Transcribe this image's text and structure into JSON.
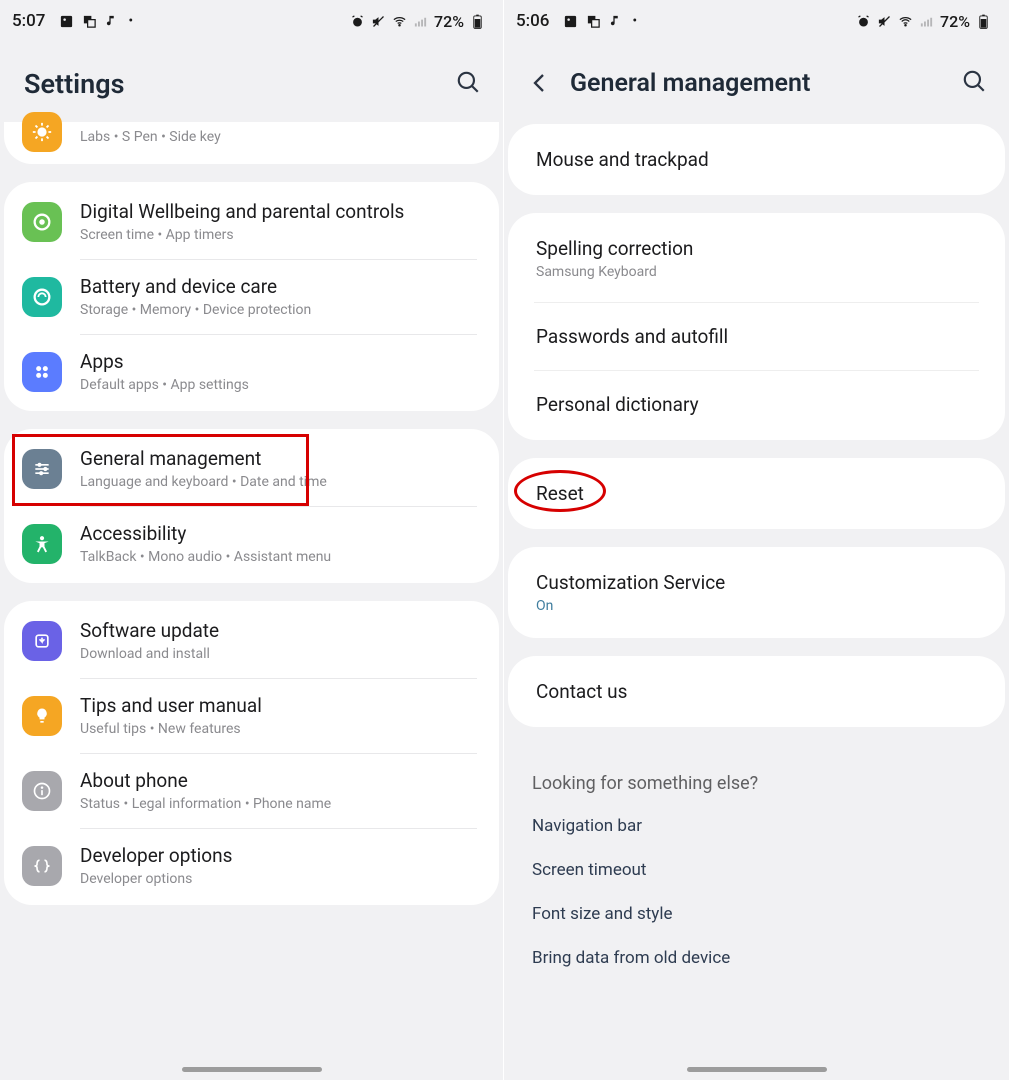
{
  "left": {
    "status": {
      "time": "5:07",
      "battery": "72%"
    },
    "title": "Settings",
    "advanced_sub": "Labs  •  S Pen  •  Side key",
    "groups": [
      [
        {
          "icon": "wellbeing",
          "color": "#69c154",
          "title": "Digital Wellbeing and parental controls",
          "sub": "Screen time  •  App timers"
        },
        {
          "icon": "battery",
          "color": "#1fb9a0",
          "title": "Battery and device care",
          "sub": "Storage  •  Memory  •  Device protection"
        },
        {
          "icon": "apps",
          "color": "#5b7cff",
          "title": "Apps",
          "sub": "Default apps  •  App settings"
        }
      ],
      [
        {
          "icon": "sliders",
          "color": "#6b8093",
          "title": "General management",
          "sub": "Language and keyboard  •  Date and time",
          "highlight": true
        },
        {
          "icon": "a11y",
          "color": "#23b36a",
          "title": "Accessibility",
          "sub": "TalkBack  •  Mono audio  •  Assistant menu"
        }
      ],
      [
        {
          "icon": "update",
          "color": "#6a62e6",
          "title": "Software update",
          "sub": "Download and install"
        },
        {
          "icon": "tips",
          "color": "#f5a623",
          "title": "Tips and user manual",
          "sub": "Useful tips  •  New features"
        },
        {
          "icon": "about",
          "color": "#a8a8ad",
          "title": "About phone",
          "sub": "Status  •  Legal information  •  Phone name"
        },
        {
          "icon": "dev",
          "color": "#a8a8ad",
          "title": "Developer options",
          "sub": "Developer options"
        }
      ]
    ]
  },
  "right": {
    "status": {
      "time": "5:06",
      "battery": "72%"
    },
    "title": "General management",
    "items": [
      {
        "title": "Mouse and trackpad"
      },
      {
        "divider": true
      },
      {
        "title": "Spelling correction",
        "sub": "Samsung Keyboard"
      },
      {
        "title": "Passwords and autofill"
      },
      {
        "title": "Personal dictionary"
      },
      {
        "divider": true
      },
      {
        "title": "Reset",
        "highlight": true
      },
      {
        "divider": true
      },
      {
        "title": "Customization Service",
        "sub": "On",
        "sub_color": "#3f7d9e"
      },
      {
        "divider": true
      },
      {
        "title": "Contact us"
      }
    ],
    "looking_header": "Looking for something else?",
    "suggestions": [
      "Navigation bar",
      "Screen timeout",
      "Font size and style",
      "Bring data from old device"
    ]
  }
}
